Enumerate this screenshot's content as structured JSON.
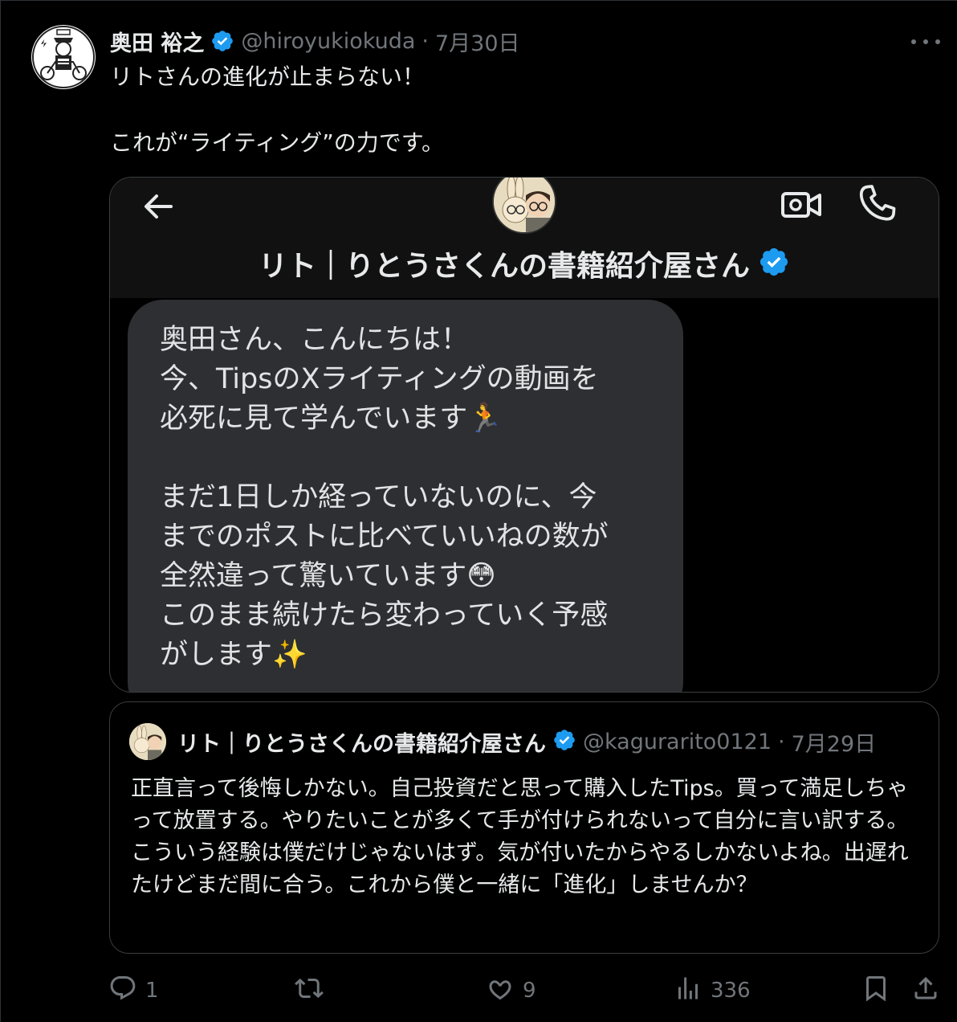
{
  "tweet": {
    "author_name": "奥田 裕之",
    "handle": "@hiroyukiokuda",
    "separator": "·",
    "date": "7月30日",
    "text": "リトさんの進化が止まらない！\n\nこれが“ライティング”の力です。"
  },
  "dm_screenshot": {
    "contact_name": "リト｜りとうさくんの書籍紹介屋さん",
    "message": "奥田さん、こんにちは！\n今、TipsのXライティングの動画を\n必死に見て学んでいます🏃\n\nまだ1日しか経っていないのに、今\nまでのポストに比べていいねの数が\n全然違って驚いています😳\nこのまま続けたら変わっていく予感\nがします✨"
  },
  "quote": {
    "author_name": "リト｜りとうさくんの書籍紹介屋さん",
    "handle": "@kagurarito0121",
    "separator": "·",
    "date": "7月29日",
    "text": "正直言って後悔しかない。自己投資だと思って購入したTips。買って満足しちゃって放置する。やりたいことが多くて手が付けられないって自分に言い訳する。こういう経験は僕だけじゃないはず。気が付いたからやるしかないよね。出遅れたけどまだ間に合う。これから僕と一緒に「進化」しませんか？"
  },
  "actions": {
    "reply_count": "1",
    "repost_count": "",
    "like_count": "9",
    "view_count": "336"
  },
  "colors": {
    "background": "#000000",
    "text": "#e7e9ea",
    "muted": "#71767b",
    "verified": "#1d9bf0",
    "bubble": "#2e2f32"
  },
  "icons": [
    "verified-badge-icon",
    "more-icon",
    "back-arrow-icon",
    "video-call-icon",
    "phone-icon",
    "reply-icon",
    "repost-icon",
    "like-icon",
    "views-icon",
    "bookmark-icon",
    "share-icon"
  ]
}
